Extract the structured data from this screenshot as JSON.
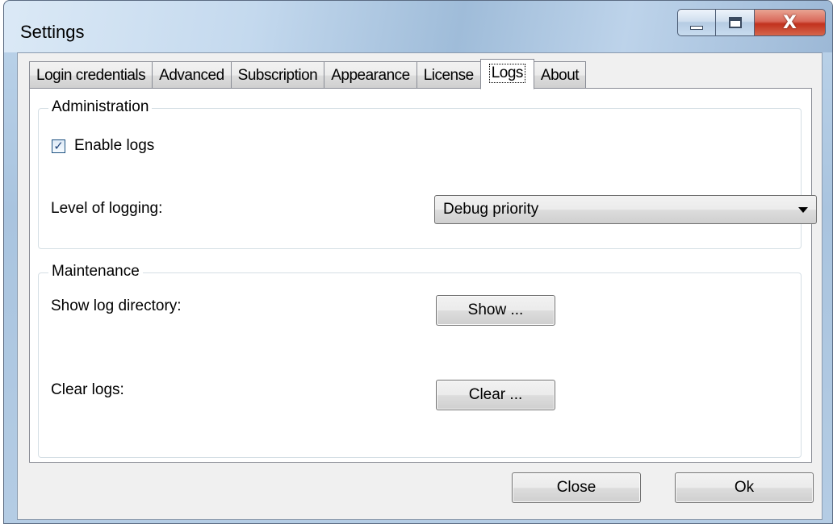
{
  "window": {
    "title": "Settings"
  },
  "tabs": [
    {
      "label": "Login credentials"
    },
    {
      "label": "Advanced"
    },
    {
      "label": "Subscription"
    },
    {
      "label": "Appearance"
    },
    {
      "label": "License"
    },
    {
      "label": "Logs",
      "active": true
    },
    {
      "label": "About"
    }
  ],
  "administration": {
    "legend": "Administration",
    "enable_logs_label": "Enable logs",
    "enable_logs_checked": true,
    "level_label": "Level of logging:",
    "level_value": "Debug priority"
  },
  "maintenance": {
    "legend": "Maintenance",
    "show_dir_label": "Show log directory:",
    "show_button": "Show ...",
    "clear_label": "Clear logs:",
    "clear_button": "Clear ..."
  },
  "footer": {
    "close_button": "Close",
    "ok_button": "Ok"
  },
  "icons": {
    "checkmark": "✓",
    "close": "X"
  }
}
